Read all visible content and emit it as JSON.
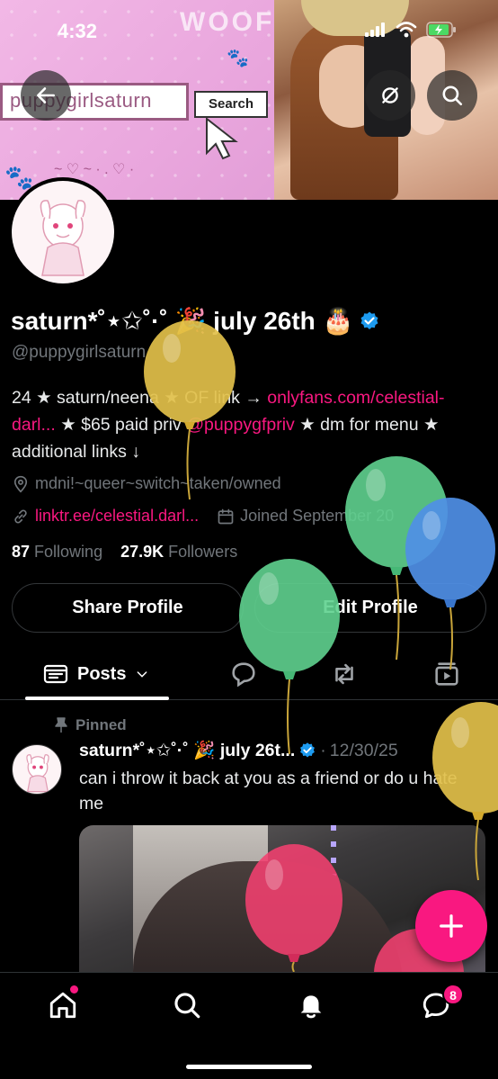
{
  "status_bar": {
    "time": "4:32"
  },
  "banner": {
    "search_text": "puppygirlsaturn",
    "search_button": "Search",
    "woof": "WOOF!"
  },
  "profile": {
    "display_name": "saturn*˚⋆✩˚·˚ 🎉 july 26th 🎂",
    "handle": "@puppygirlsaturn",
    "bio": {
      "part1": "24 ★ saturn/neena ★ OF link → ",
      "link1": "onlyfans.com/celestial-darl...",
      "part2": " ★ $65 paid priv ",
      "link2": "@puppygfpriv",
      "part3": " ★ dm for menu ★ additional links ↓"
    },
    "location": "mdni!~queer~switch~taken/owned",
    "website": "linktr.ee/celestial.darl...",
    "joined": "Joined September 20",
    "following_count": "87",
    "following_label": "Following",
    "followers_count": "27.9K",
    "followers_label": "Followers"
  },
  "buttons": {
    "share_profile": "Share Profile",
    "edit_profile": "Edit Profile"
  },
  "tabs": {
    "posts": "Posts"
  },
  "post": {
    "pinned_label": "Pinned",
    "author": "saturn*˚⋆✩˚·˚ 🎉 july 26t...",
    "separator": "·",
    "date": "12/30/25",
    "text": "can i throw it back at you as a friend or do u hate me"
  },
  "nav": {
    "messages_badge": "8"
  },
  "colors": {
    "accent": "#f91880",
    "verified": "#1d9bf0",
    "muted": "#71767b",
    "balloon_yellow": "#e2c04a",
    "balloon_green": "#5fd18f",
    "balloon_blue": "#4f8fe6",
    "balloon_pink": "#f2406f"
  }
}
